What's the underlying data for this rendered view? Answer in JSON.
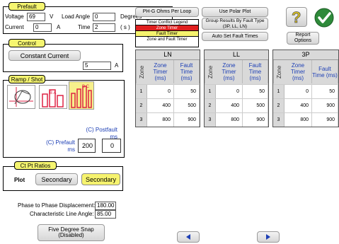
{
  "prefault": {
    "title": "Prefault",
    "voltage_label": "Voltage",
    "voltage_value": "69",
    "voltage_unit": "V",
    "load_angle_label": "Load Angle",
    "load_angle_value": "0",
    "load_angle_unit": "Degrees",
    "current_label": "Current",
    "current_value": "0",
    "current_unit": "A",
    "time_label": "Time",
    "time_value": "2",
    "time_unit": "( s )"
  },
  "control": {
    "title": "Control",
    "constant_current_label": "Constant Current",
    "current_value": "5",
    "current_unit": "A"
  },
  "ramp_shot": {
    "title": "Ramp / Shot",
    "thumbnails": [
      "shot-impedance-icon",
      "ramp-icon",
      "pulse-ramp-icon"
    ],
    "selected_index": 2,
    "thumb_labels": [
      "",
      "B A",
      "B C"
    ],
    "postfault_label": "(C) Postfault ms",
    "prefault_label": "(C) Prefault ms",
    "prefault_value": "200",
    "postfault_value": "0"
  },
  "ct_pt": {
    "title": "Ct Pt Ratios",
    "plot_label": "Plot",
    "secondary_1": "Secondary",
    "secondary_2": "Secondary"
  },
  "angles": {
    "phase_label": "Phase to Phase Displacement:",
    "phase_value": "180.00",
    "char_label": "Characteristic Line Angle:",
    "char_value": "85.00"
  },
  "snap_button": "Five Degree Snap\n(Disabled)",
  "toolbar": {
    "phg_ohms": "PH-G Ohms Per Loop",
    "use_polar": "Use Polar Plot",
    "group_results": "Group Results By Fault Type (3P, LL, LN)",
    "auto_set": "Auto Set Fault Times",
    "report_options": "Report Options"
  },
  "legend": {
    "title": "Timer Conflict Legend",
    "zone_timer": "Zone Timer",
    "fault_timer": "Fault Timer",
    "zone_and_fault": "Zone and Fault Timer",
    "colors": {
      "zone": "#e02020",
      "fault": "#f6f36e"
    }
  },
  "tables": [
    {
      "title": "LN",
      "headers": [
        "Zone",
        "Zone Timer (ms)",
        "Fault Time (ms)"
      ],
      "rows": [
        [
          "1",
          "0",
          "50"
        ],
        [
          "2",
          "400",
          "500"
        ],
        [
          "3",
          "800",
          "900"
        ]
      ]
    },
    {
      "title": "LL",
      "headers": [
        "Zone",
        "Zone Timer (ms)",
        "Fault Time (ms)"
      ],
      "rows": [
        [
          "1",
          "0",
          "50"
        ],
        [
          "2",
          "400",
          "500"
        ],
        [
          "3",
          "800",
          "900"
        ]
      ]
    },
    {
      "title": "3P",
      "headers": [
        "Zone",
        "Zone Timer (ms)",
        "Fault Time (ms)"
      ],
      "rows": [
        [
          "1",
          "0",
          "50"
        ],
        [
          "2",
          "400",
          "900"
        ],
        [
          "3",
          "800",
          "900"
        ]
      ]
    }
  ],
  "nav": {
    "prev": "previous-arrow-icon",
    "next": "next-arrow-icon"
  },
  "icons": {
    "help": "help-question-icon",
    "ok": "ok-check-icon"
  }
}
